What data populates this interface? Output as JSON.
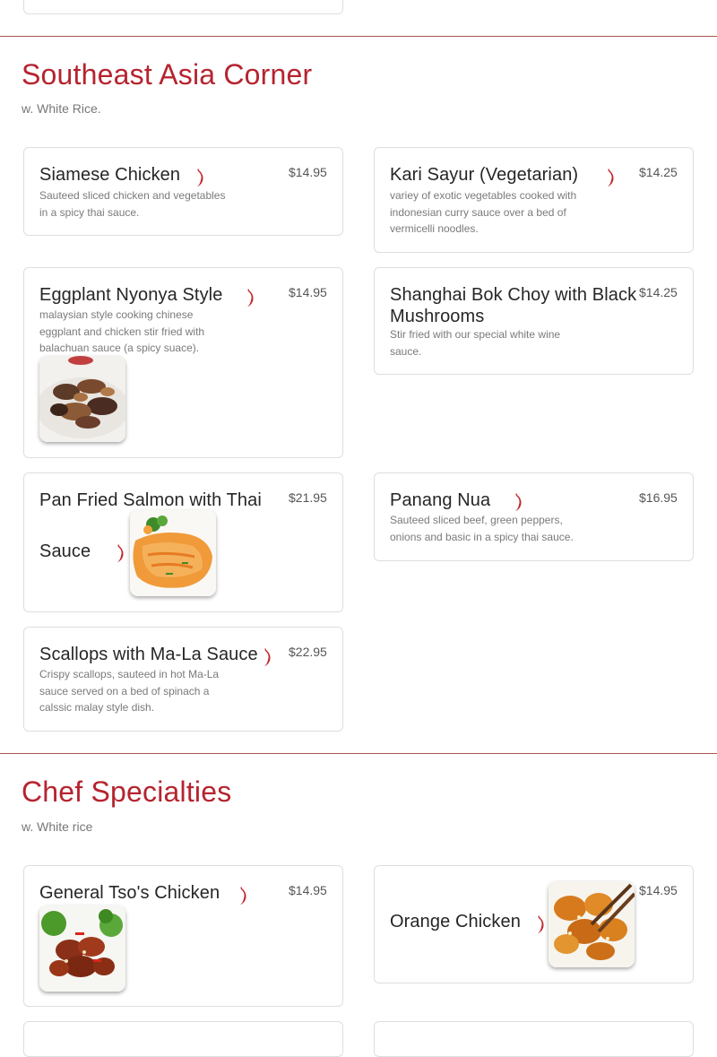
{
  "sections": [
    {
      "title": "Southeast Asia Corner",
      "subtitle": "w. White Rice.",
      "items": [
        {
          "name": "Siamese Chicken",
          "price": "$14.95",
          "description": "Sauteed sliced chicken and vegetables in a spicy thai sauce.",
          "spicy": true
        },
        {
          "name": "Kari Sayur (Vegetarian)",
          "price": "$14.25",
          "description": "variey of exotic vegetables cooked with indonesian curry sauce over a bed of vermicelli noodles.",
          "spicy": true
        },
        {
          "name": "Eggplant Nyonya Style",
          "price": "$14.95",
          "description": "malaysian style cooking chinese eggplant and chicken stir fried with balachuan sauce (a spicy suace).",
          "spicy": true,
          "image": "eggplant-dish-photo"
        },
        {
          "name": "Shanghai Bok Choy with Black Mushrooms",
          "price": "$14.25",
          "description": "Stir fried with our special white wine sauce.",
          "spicy": false
        },
        {
          "name": "Pan Fried Salmon with Thai Sauce",
          "price": "$21.95",
          "description": "",
          "spicy": true,
          "image": "salmon-dish-photo"
        },
        {
          "name": "Panang Nua",
          "price": "$16.95",
          "description": "Sauteed sliced beef, green peppers, onions and basic in a spicy thai sauce.",
          "spicy": true
        },
        {
          "name": "Scallops with Ma-La Sauce",
          "price": "$22.95",
          "description": "Crispy scallops, sauteed in hot Ma-La sauce served on a bed of spinach a calssic malay style dish.",
          "spicy": true
        }
      ]
    },
    {
      "title": "Chef Specialties",
      "subtitle": "w. White rice",
      "items": [
        {
          "name": "General Tso's Chicken",
          "price": "$14.95",
          "description": "",
          "spicy": true,
          "image": "general-tso-dish-photo"
        },
        {
          "name": "Orange Chicken",
          "price": "$14.95",
          "description": "",
          "spicy": true,
          "image": "orange-chicken-dish-photo"
        }
      ]
    }
  ],
  "icons": {
    "spicy": "chili-pepper-icon"
  },
  "colors": {
    "accent": "#b5242f",
    "divider": "#a8554f",
    "card_border": "#dedede",
    "pepper": "#c0282d"
  }
}
